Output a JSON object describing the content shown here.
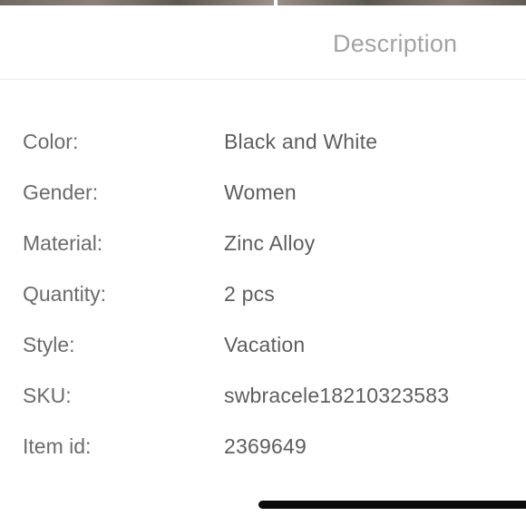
{
  "tabs": {
    "description_label": "Description"
  },
  "specs": [
    {
      "label": "Color:",
      "value": "Black and White"
    },
    {
      "label": "Gender:",
      "value": "Women"
    },
    {
      "label": "Material:",
      "value": "Zinc Alloy"
    },
    {
      "label": "Quantity:",
      "value": "2 pcs"
    },
    {
      "label": "Style:",
      "value": "Vacation"
    },
    {
      "label": "SKU:",
      "value": "swbracele18210323583"
    },
    {
      "label": "Item id:",
      "value": "2369649"
    }
  ],
  "colors": {
    "label_text": "#6b6b6b",
    "value_text": "#5e5e5e",
    "tab_text": "#a3a3a3",
    "home_indicator": "#0b0b0b"
  }
}
